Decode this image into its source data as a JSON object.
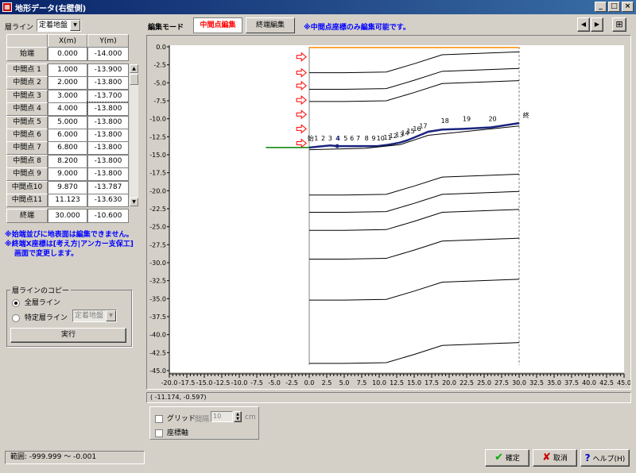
{
  "window": {
    "title": "地形データ(右壁側)",
    "icon": "app-icon",
    "controls": [
      "minimize-icon",
      "maximize-icon",
      "close-icon"
    ]
  },
  "left": {
    "layer_label": "層ライン",
    "layer_select": "定着地盤",
    "col_x": "X(m)",
    "col_y": "Y(m)",
    "start": {
      "label": "始端",
      "x": "0.000",
      "y": "-14.000"
    },
    "rows": [
      {
        "label": "中間点 1",
        "x": "1.000",
        "y": "-13.900"
      },
      {
        "label": "中間点 2",
        "x": "2.000",
        "y": "-13.800"
      },
      {
        "label": "中間点 3",
        "x": "3.000",
        "y": "-13.700"
      },
      {
        "label": "中間点 4",
        "x": "4.000",
        "y": "-13.800"
      },
      {
        "label": "中間点 5",
        "x": "5.000",
        "y": "-13.800"
      },
      {
        "label": "中間点 6",
        "x": "6.000",
        "y": "-13.800"
      },
      {
        "label": "中間点 7",
        "x": "6.800",
        "y": "-13.800"
      },
      {
        "label": "中間点 8",
        "x": "8.200",
        "y": "-13.800"
      },
      {
        "label": "中間点 9",
        "x": "9.000",
        "y": "-13.800"
      },
      {
        "label": "中間点10",
        "x": "9.870",
        "y": "-13.787"
      },
      {
        "label": "中間点11",
        "x": "11.123",
        "y": "-13.630"
      }
    ],
    "end": {
      "label": "終端",
      "x": "30.000",
      "y": "-10.600"
    },
    "note1": "※始端並びに地表面は編集できません。",
    "note2": "※終端X座標は[考え方|アンカー支保工]",
    "note3": "画面で変更します。",
    "copy": {
      "group_label": "層ラインのコピー",
      "all_label": "全層ライン",
      "specific_label": "特定層ライン",
      "specific_select": "定着地盤",
      "run_label": "実行"
    },
    "range": "範囲: -999.999 ～ -0.001"
  },
  "toolbar": {
    "mode_label": "編集モード",
    "mid_edit": "中間点編集",
    "end_edit": "終端編集",
    "notice": "※中間点座標のみ編集可能です。"
  },
  "plot": {
    "coord_readout": "( -11.174,  -0.597)",
    "grid_label": "グリッド",
    "interval_label": "間隔",
    "interval_value": "10",
    "unit": "cm",
    "axis_label": "座標軸",
    "point_labels": [
      "始",
      "1",
      "2",
      "3",
      "4",
      "5",
      "6",
      "7",
      "8",
      "9",
      "10",
      "11",
      "12",
      "13",
      "14",
      "15",
      "16",
      "17",
      "18",
      "19",
      "20",
      "終"
    ]
  },
  "footer": {
    "ok": "確定",
    "cancel": "取消",
    "help": "ヘルプ(H)"
  },
  "chart_data": {
    "type": "line",
    "xlim": [
      -20.0,
      45.0
    ],
    "ylim": [
      -45.0,
      0.0
    ],
    "x_ticks": [
      -20.0,
      -17.5,
      -15.0,
      -12.5,
      -10.0,
      -7.5,
      -5.0,
      -2.5,
      0.0,
      2.5,
      5.0,
      7.5,
      10.0,
      12.5,
      15.0,
      17.5,
      20.0,
      22.5,
      25.0,
      27.5,
      30.0,
      32.5,
      35.0,
      37.5,
      40.0,
      42.5,
      45.0
    ],
    "y_ticks": [
      0.0,
      -2.5,
      -5.0,
      -7.5,
      -10.0,
      -12.5,
      -15.0,
      -17.5,
      -20.0,
      -22.5,
      -25.0,
      -27.5,
      -30.0,
      -32.5,
      -35.0,
      -37.5,
      -40.0,
      -42.5,
      -45.0
    ],
    "colors": {
      "surface": "#ff8c00",
      "active": "#1a237e",
      "ground": "#008000",
      "layer": "#000000",
      "arrow": "#ff0000"
    }
  }
}
